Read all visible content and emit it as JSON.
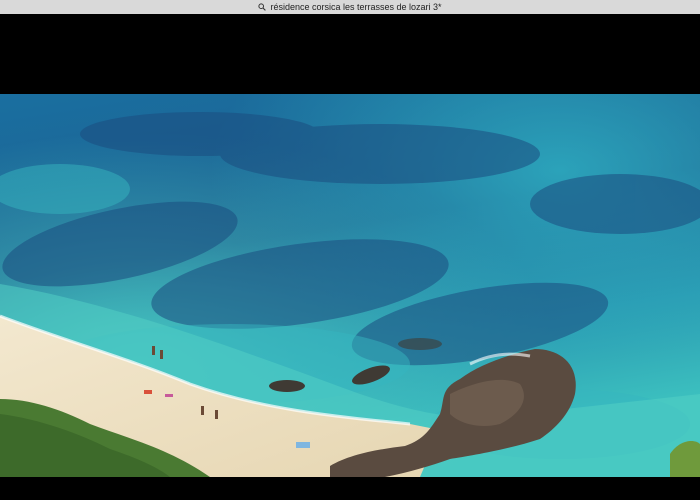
{
  "search": {
    "query": "résidence corsica les terrasses de lozari 3*",
    "icon": "search-icon"
  },
  "photo": {
    "subject": "aerial-beach-photo",
    "colors": {
      "deep_sea": "#1d5f8f",
      "shallow_sea": "#2fb3b8",
      "sand": "#efe2c4",
      "rock": "#5a4b40",
      "vegetation": "#4a7a32"
    }
  }
}
